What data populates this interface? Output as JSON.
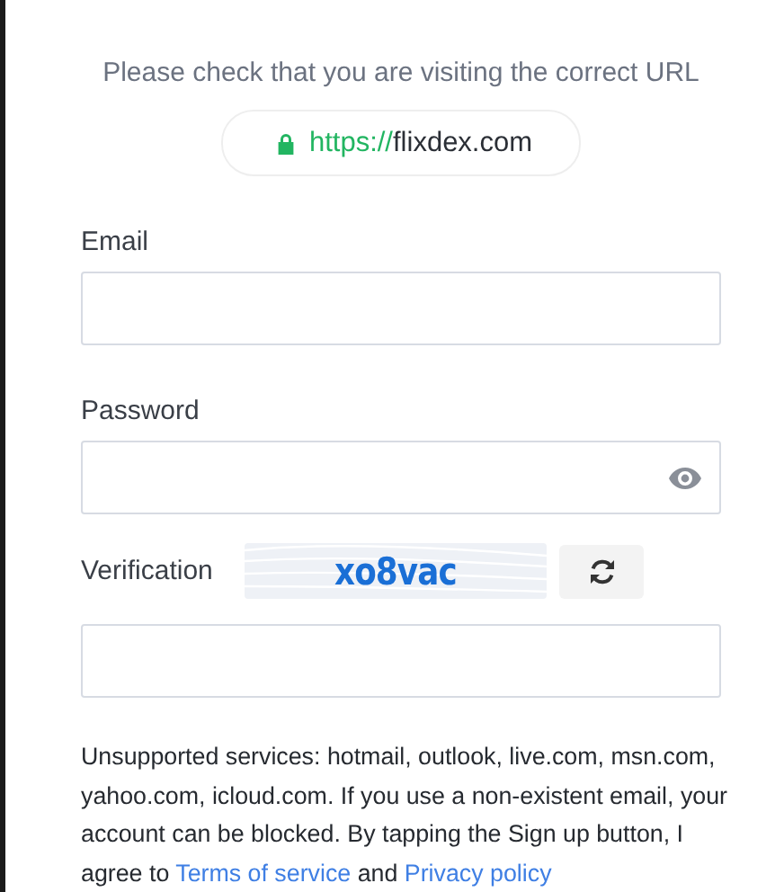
{
  "url_notice": {
    "message": "Please check that you are visiting the correct URL",
    "scheme": "https://",
    "host": "flixdex.com"
  },
  "fields": [
    {
      "label": "Email",
      "kind": "text"
    },
    {
      "label": "Password",
      "kind": "password"
    }
  ],
  "verification": {
    "label": "Verification",
    "captcha": "xo8vac"
  },
  "notice": {
    "text": "Unsupported services: hotmail, outlook, live.com, msn.com, yahoo.com, icloud.com. If you use a non-existent email, your account can be blocked. By tapping the Sign up button, I agree to ",
    "terms_link": "Terms of service",
    "conjunction": " and ",
    "privacy_link": "Privacy policy"
  }
}
